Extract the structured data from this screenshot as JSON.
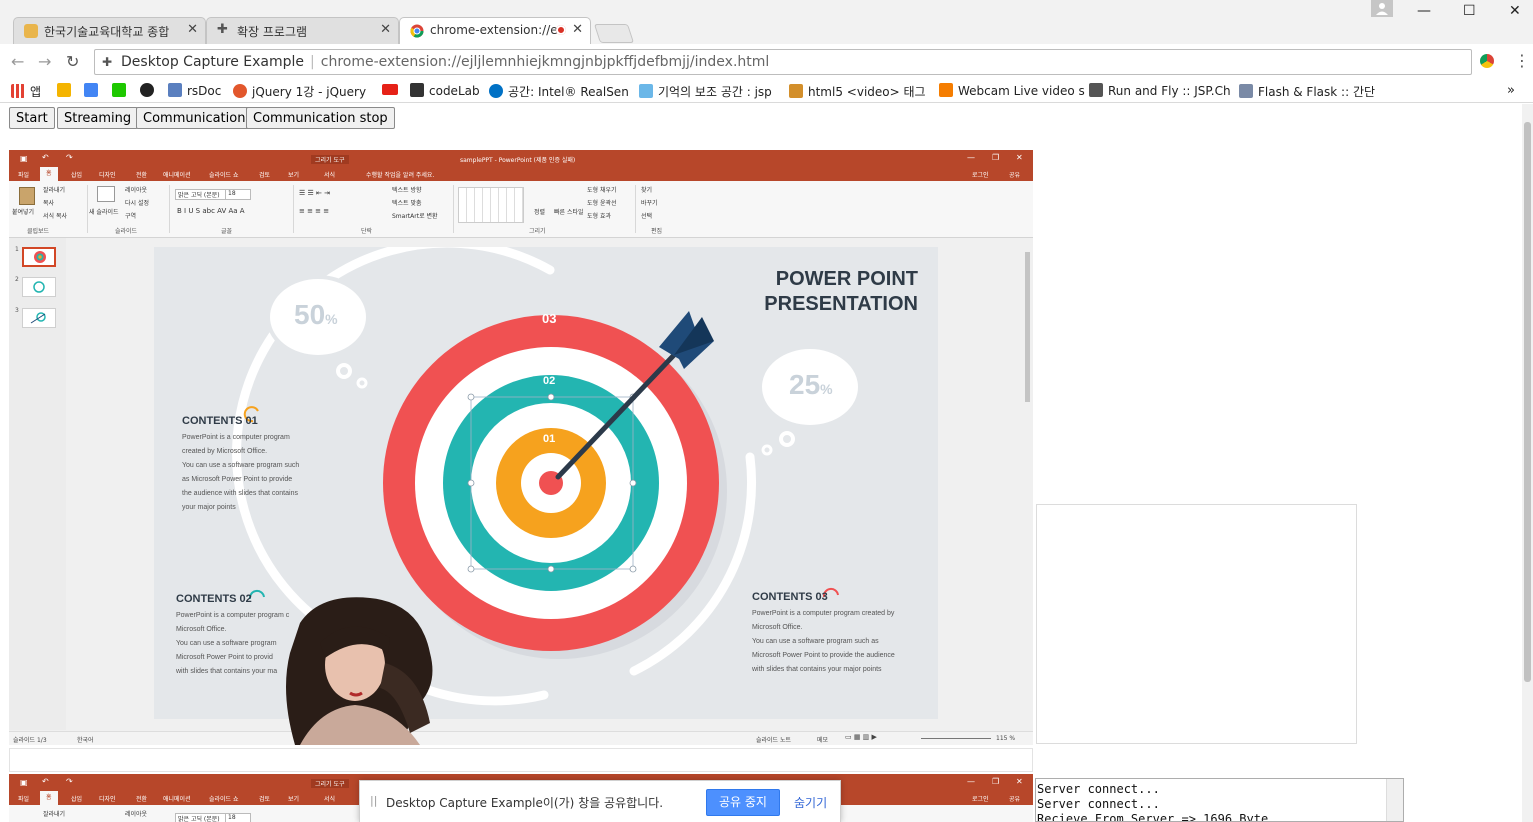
{
  "browser": {
    "tabs": [
      {
        "title": "한국기술교육대학교 종합",
        "active": false
      },
      {
        "title": "확장 프로그램",
        "active": false
      },
      {
        "title": "chrome-extension://e",
        "active": true
      }
    ],
    "omnibox": {
      "site": "Desktop Capture Example",
      "url": "chrome-extension://ejljlemnhiejkmngjnbjpkffjdefbmjj/index.html"
    },
    "bookmarks": [
      {
        "label": "앱",
        "color": "#e34133"
      },
      {
        "label": "",
        "color": "#f4b400"
      },
      {
        "label": "",
        "color": "#4285f4"
      },
      {
        "label": "",
        "color": "#1ec800"
      },
      {
        "label": "",
        "color": "#222222"
      },
      {
        "label": "rsDoc",
        "color": "#5a7fbf"
      },
      {
        "label": "jQuery 1강 - jQuery",
        "color": "#e2572c"
      },
      {
        "label": "",
        "color": "#e62117"
      },
      {
        "label": "codeLab",
        "color": "#333333"
      },
      {
        "label": "공간: Intel® RealSen",
        "color": "#0071c5"
      },
      {
        "label": "기억의 보조 공간 : jsp",
        "color": "#6bb7e8"
      },
      {
        "label": "html5 <video> 태그",
        "color": "#d38f2b"
      },
      {
        "label": "Webcam Live video s",
        "color": "#f57d00"
      },
      {
        "label": "Run and Fly :: JSP.Ch",
        "color": "#555555"
      },
      {
        "label": "Flash & Flask :: 간단",
        "color": "#7a8aa6"
      }
    ],
    "more_label": "»"
  },
  "page": {
    "buttons": {
      "start": "Start",
      "streaming": "Streaming",
      "communication": "Communication",
      "communication_stop": "Communication stop"
    },
    "log": [
      "Server connect...",
      "Server connect...",
      "Recieve From Server => 1696 Byte"
    ],
    "share_banner": {
      "grip": "||",
      "message": "Desktop Capture Example이(가) 창을 공유합니다.",
      "stop": "공유 중지",
      "hide": "숨기기"
    }
  },
  "ppt": {
    "title": "samplePPT - PowerPoint (제품 인증 실패)",
    "drawing_tools": "그리기 도구",
    "login": "로그인",
    "share": "공유",
    "menu": [
      "파일",
      "홈",
      "삽입",
      "디자인",
      "전환",
      "애니메이션",
      "슬라이드 쇼",
      "검토",
      "보기",
      "서식"
    ],
    "tell_me": "수행할 작업을 알려 주세요.",
    "ribbon_groups": [
      "클립보드",
      "슬라이드",
      "글꼴",
      "단락",
      "그리기",
      "편집"
    ],
    "ribbon_items": {
      "paste": "붙여넣기",
      "cut": "잘라내기",
      "copy": "복사",
      "format_painter": "서식 복사",
      "new_slide": "새 슬라이드",
      "layout": "레이아웃",
      "reset": "다시 설정",
      "section": "구역",
      "font": "맑은 고딕 (본문)",
      "font_size": "18",
      "text_direction": "텍스트 방향",
      "align_text": "텍스트 맞춤",
      "smartart": "SmartArt로 변환",
      "arrange": "정렬",
      "quick_styles": "빠른 스타일",
      "shape_fill": "도형 채우기",
      "shape_outline": "도형 윤곽선",
      "shape_effects": "도형 효과",
      "find": "찾기",
      "replace": "바꾸기",
      "select": "선택"
    },
    "status": {
      "slide": "슬라이드 1/3",
      "language": "한국어",
      "notes": "슬라이드 노트",
      "comments": "메모",
      "zoom": "115 %"
    },
    "slide": {
      "heading_line1": "POWER POINT",
      "heading_line2": "PRESENTATION",
      "bubble_left": "50",
      "bubble_right": "25",
      "percent": "%",
      "ring_outer": "03",
      "ring_middle": "02",
      "ring_inner": "01",
      "contents": [
        {
          "title": "CONTENTS 01",
          "lines": [
            "PowerPoint is a computer program",
            "created by Microsoft Office.",
            "You can use a software program such",
            "as Microsoft Power Point to provide",
            "the audience with slides that contains",
            "your major points"
          ]
        },
        {
          "title": "CONTENTS 02",
          "lines": [
            "PowerPoint is a computer program c",
            "Microsoft Office.",
            "You can use a software program",
            "Microsoft Power Point to provid",
            "with slides that contains your ma"
          ]
        },
        {
          "title": "CONTENTS 03",
          "lines": [
            "PowerPoint is a computer program created by",
            "Microsoft Office.",
            "You can use a software program such as",
            "Microsoft Power Point to provide the audience",
            "with slides that contains your major points"
          ]
        }
      ],
      "colors": {
        "red": "#f05152",
        "teal": "#23b5b1",
        "orange": "#f6a21e",
        "dart": "#1f4a78",
        "shaft": "#2c3a4a"
      }
    }
  }
}
